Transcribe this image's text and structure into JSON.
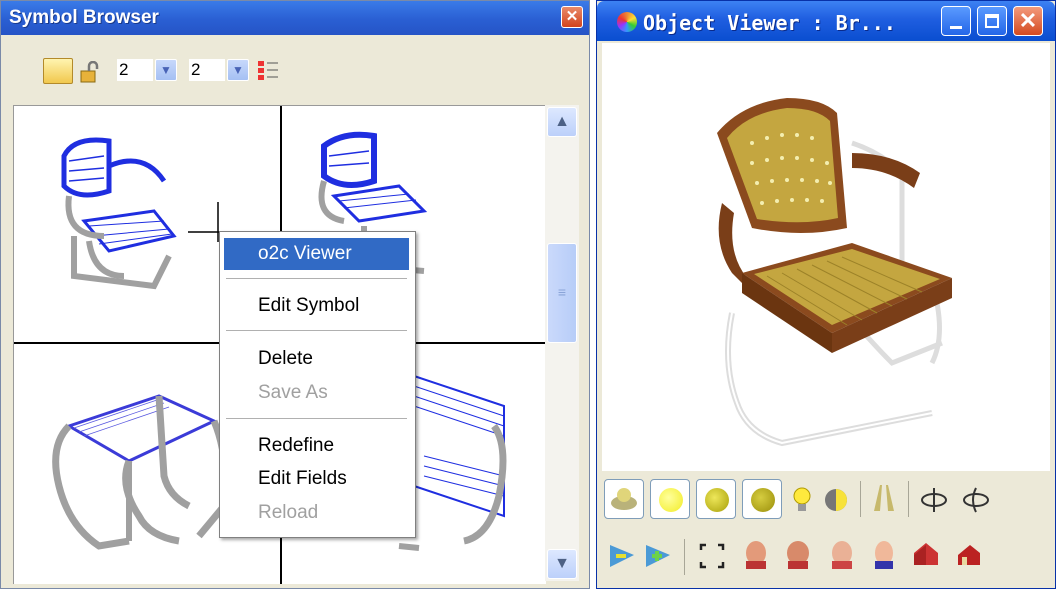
{
  "symbol_browser": {
    "title": "Symbol Browser",
    "toolbar": {
      "folder_icon": "folder-icon",
      "lock_icon": "unlock-icon",
      "rows_value": "2",
      "cols_value": "2",
      "list_icon": "checklist-icon"
    },
    "context_menu": {
      "items": [
        {
          "label": "o2c Viewer",
          "selected": true
        },
        {
          "label": "Edit Symbol"
        },
        {
          "label": "Delete"
        },
        {
          "label": "Save As",
          "disabled": true
        },
        {
          "label": "Redefine"
        },
        {
          "label": "Edit Fields"
        },
        {
          "label": "Reload",
          "disabled": true
        }
      ]
    },
    "colors": {
      "wireframe": "#0000cc",
      "tube": "#a0a0a0",
      "highlight": "#316ac5"
    }
  },
  "object_viewer": {
    "title": "Object Viewer : Br...",
    "toolbar1": [
      "shading-flat-icon",
      "sphere-bright-icon",
      "sphere-medium-icon",
      "sphere-dark-icon",
      "lightbulb-icon",
      "contrast-icon",
      "perspective-icon",
      "rotate-left-icon",
      "rotate-right-icon"
    ],
    "toolbar2": [
      "zoom-out-icon",
      "zoom-in-icon",
      "fit-view-icon",
      "head-front-icon",
      "head-side-icon",
      "head-back-icon",
      "head-top-icon",
      "house-icon",
      "house-side-icon"
    ],
    "colors": {
      "seat": "#c4a640",
      "frame": "#8b4a1e"
    }
  }
}
